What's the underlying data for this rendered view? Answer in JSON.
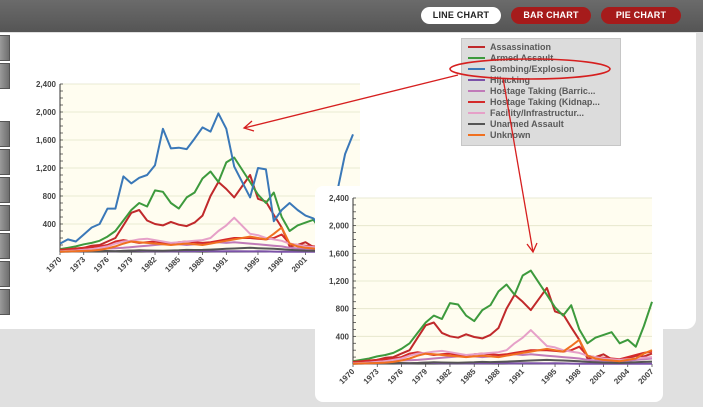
{
  "toolbar": {
    "line_chart_label": "LINE CHART",
    "bar_chart_label": "BAR CHART",
    "pie_chart_label": "PIE CHART"
  },
  "legend": {
    "items": [
      {
        "label": "Assassination",
        "color": "#c0292b"
      },
      {
        "label": "Armed Assault",
        "color": "#3d9a3d"
      },
      {
        "label": "Bombing/Explosion",
        "color": "#3a78b8"
      },
      {
        "label": "Hijacking",
        "color": "#7b52a8"
      },
      {
        "label": "Hostage Taking (Barric...",
        "color": "#c07ab8"
      },
      {
        "label": "Hostage Taking (Kidnap...",
        "color": "#d42a2a"
      },
      {
        "label": "Facility/Infrastructur...",
        "color": "#e6a0c8"
      },
      {
        "label": "Unarmed Assault",
        "color": "#555555"
      },
      {
        "label": "Unknown",
        "color": "#f07020"
      }
    ]
  },
  "annotation": {
    "color": "#d61f1f"
  },
  "chart_data": [
    {
      "type": "line",
      "ylim": [
        0,
        2400
      ],
      "yticks": [
        "2,400",
        "2,000",
        "1,600",
        "1,200",
        "800",
        "400"
      ],
      "xtick_labels": [
        "1970",
        "1973",
        "1976",
        "1979",
        "1982",
        "1985",
        "1988",
        "1991",
        "1995",
        "1998",
        "2001"
      ],
      "x": [
        1970,
        1971,
        1972,
        1973,
        1974,
        1975,
        1976,
        1977,
        1978,
        1979,
        1980,
        1981,
        1982,
        1983,
        1984,
        1985,
        1986,
        1987,
        1988,
        1989,
        1990,
        1991,
        1992,
        1994,
        1995,
        1996,
        1997,
        1998,
        1999,
        2000,
        2001,
        2002,
        2003,
        2004,
        2005,
        2006,
        2007
      ],
      "series": [
        {
          "name": "Assassination",
          "color": "#c0292b",
          "values": [
            20,
            30,
            40,
            60,
            90,
            100,
            150,
            200,
            380,
            560,
            600,
            450,
            400,
            380,
            430,
            390,
            370,
            420,
            520,
            800,
            1000,
            900,
            780,
            1100,
            760,
            720,
            530,
            350,
            80,
            100,
            140,
            70,
            60,
            80,
            120,
            110,
            150
          ]
        },
        {
          "name": "Armed Assault",
          "color": "#3d9a3d",
          "values": [
            40,
            60,
            80,
            110,
            130,
            160,
            220,
            300,
            450,
            600,
            700,
            650,
            880,
            860,
            700,
            620,
            780,
            850,
            1050,
            1150,
            1000,
            1280,
            1350,
            1000,
            820,
            700,
            850,
            500,
            300,
            380,
            420,
            460,
            300,
            350,
            250,
            550,
            900
          ]
        },
        {
          "name": "Bombing/Explosion",
          "color": "#3a78b8",
          "values": [
            120,
            180,
            150,
            250,
            350,
            400,
            620,
            620,
            1080,
            980,
            1060,
            1100,
            1240,
            1760,
            1480,
            1490,
            1470,
            1620,
            1780,
            1720,
            1980,
            1760,
            1220,
            780,
            1200,
            1180,
            440,
            600,
            700,
            600,
            520,
            480,
            360,
            560,
            860,
            1400,
            1680
          ]
        },
        {
          "name": "Hijacking",
          "color": "#7b52a8",
          "values": [
            10,
            15,
            12,
            10,
            20,
            15,
            12,
            10,
            15,
            20,
            15,
            10,
            12,
            10,
            8,
            10,
            12,
            10,
            15,
            10,
            8,
            10,
            12,
            8,
            10,
            8,
            6,
            5,
            5,
            5,
            4,
            4,
            3,
            4,
            5,
            4,
            3
          ]
        },
        {
          "name": "Hostage Taking (Barricade Incident)",
          "color": "#c07ab8",
          "values": [
            20,
            25,
            30,
            35,
            40,
            45,
            50,
            55,
            60,
            70,
            80,
            90,
            100,
            110,
            120,
            110,
            100,
            110,
            120,
            130,
            140,
            130,
            140,
            120,
            110,
            100,
            90,
            80,
            60,
            50,
            40,
            35,
            40,
            45,
            60,
            70,
            80
          ]
        },
        {
          "name": "Hostage Taking (Kidnapping)",
          "color": "#d42a2a",
          "values": [
            30,
            40,
            50,
            60,
            70,
            80,
            100,
            150,
            170,
            150,
            130,
            140,
            150,
            130,
            120,
            140,
            150,
            140,
            130,
            140,
            160,
            180,
            200,
            200,
            190,
            180,
            200,
            250,
            120,
            100,
            90,
            80,
            70,
            100,
            130,
            160,
            180
          ]
        },
        {
          "name": "Facility/Infrastructure Attack",
          "color": "#e6a0c8",
          "values": [
            10,
            15,
            20,
            30,
            40,
            60,
            80,
            120,
            150,
            160,
            180,
            190,
            170,
            150,
            130,
            140,
            150,
            160,
            170,
            200,
            300,
            380,
            490,
            260,
            240,
            200,
            180,
            160,
            120,
            100,
            80,
            70,
            60,
            70,
            80,
            90,
            100
          ]
        },
        {
          "name": "Unarmed Assault",
          "color": "#555555",
          "values": [
            5,
            6,
            8,
            10,
            12,
            15,
            14,
            12,
            15,
            20,
            25,
            22,
            20,
            18,
            22,
            25,
            30,
            28,
            30,
            35,
            40,
            45,
            50,
            60,
            55,
            50,
            45,
            40,
            30,
            25,
            20,
            18,
            15,
            20,
            25,
            30,
            35
          ]
        },
        {
          "name": "Unknown",
          "color": "#f07020",
          "values": [
            5,
            8,
            10,
            15,
            20,
            30,
            50,
            80,
            120,
            150,
            140,
            130,
            120,
            110,
            100,
            110,
            120,
            110,
            100,
            120,
            140,
            160,
            180,
            220,
            200,
            180,
            260,
            350,
            120,
            80,
            60,
            50,
            40,
            60,
            80,
            150,
            200
          ]
        }
      ]
    },
    {
      "type": "line",
      "ylim": [
        0,
        2400
      ],
      "yticks": [
        "2,400",
        "2,000",
        "1,600",
        "1,200",
        "800",
        "400"
      ],
      "xtick_labels": [
        "1970",
        "1973",
        "1976",
        "1979",
        "1982",
        "1985",
        "1988",
        "1991",
        "1995",
        "1998",
        "2001",
        "2004",
        "2007"
      ],
      "x": [
        1970,
        1971,
        1972,
        1973,
        1974,
        1975,
        1976,
        1977,
        1978,
        1979,
        1980,
        1981,
        1982,
        1983,
        1984,
        1985,
        1986,
        1987,
        1988,
        1989,
        1990,
        1991,
        1992,
        1994,
        1995,
        1996,
        1997,
        1998,
        1999,
        2000,
        2001,
        2002,
        2003,
        2004,
        2005,
        2006,
        2007
      ],
      "series": [
        {
          "name": "Assassination",
          "color": "#c0292b",
          "values": [
            20,
            30,
            40,
            60,
            90,
            100,
            150,
            200,
            380,
            560,
            600,
            450,
            400,
            380,
            430,
            390,
            370,
            420,
            520,
            800,
            1000,
            900,
            780,
            1100,
            760,
            720,
            530,
            350,
            80,
            100,
            140,
            70,
            60,
            80,
            120,
            110,
            150
          ]
        },
        {
          "name": "Armed Assault",
          "color": "#3d9a3d",
          "values": [
            40,
            60,
            80,
            110,
            130,
            160,
            220,
            300,
            450,
            600,
            700,
            650,
            880,
            860,
            700,
            620,
            780,
            850,
            1050,
            1150,
            1000,
            1280,
            1350,
            1000,
            820,
            700,
            850,
            500,
            300,
            380,
            420,
            460,
            300,
            350,
            250,
            550,
            900
          ]
        },
        {
          "name": "Hijacking",
          "color": "#7b52a8",
          "values": [
            10,
            15,
            12,
            10,
            20,
            15,
            12,
            10,
            15,
            20,
            15,
            10,
            12,
            10,
            8,
            10,
            12,
            10,
            15,
            10,
            8,
            10,
            12,
            8,
            10,
            8,
            6,
            5,
            5,
            5,
            4,
            4,
            3,
            4,
            5,
            4,
            3
          ]
        },
        {
          "name": "Hostage Taking (Barricade Incident)",
          "color": "#c07ab8",
          "values": [
            20,
            25,
            30,
            35,
            40,
            45,
            50,
            55,
            60,
            70,
            80,
            90,
            100,
            110,
            120,
            110,
            100,
            110,
            120,
            130,
            140,
            130,
            140,
            120,
            110,
            100,
            90,
            80,
            60,
            50,
            40,
            35,
            40,
            45,
            60,
            70,
            80
          ]
        },
        {
          "name": "Hostage Taking (Kidnapping)",
          "color": "#d42a2a",
          "values": [
            30,
            40,
            50,
            60,
            70,
            80,
            100,
            150,
            170,
            150,
            130,
            140,
            150,
            130,
            120,
            140,
            150,
            140,
            130,
            140,
            160,
            180,
            200,
            200,
            190,
            180,
            200,
            250,
            120,
            100,
            90,
            80,
            70,
            100,
            130,
            160,
            180
          ]
        },
        {
          "name": "Facility/Infrastructure Attack",
          "color": "#e6a0c8",
          "values": [
            10,
            15,
            20,
            30,
            40,
            60,
            80,
            120,
            150,
            160,
            180,
            190,
            170,
            150,
            130,
            140,
            150,
            160,
            170,
            200,
            300,
            380,
            490,
            260,
            240,
            200,
            180,
            160,
            120,
            100,
            80,
            70,
            60,
            70,
            80,
            90,
            100
          ]
        },
        {
          "name": "Unarmed Assault",
          "color": "#555555",
          "values": [
            5,
            6,
            8,
            10,
            12,
            15,
            14,
            12,
            15,
            20,
            25,
            22,
            20,
            18,
            22,
            25,
            30,
            28,
            30,
            35,
            40,
            45,
            50,
            60,
            55,
            50,
            45,
            40,
            30,
            25,
            20,
            18,
            15,
            20,
            25,
            30,
            35
          ]
        },
        {
          "name": "Unknown",
          "color": "#f07020",
          "values": [
            5,
            8,
            10,
            15,
            20,
            30,
            50,
            80,
            120,
            150,
            140,
            130,
            120,
            110,
            100,
            110,
            120,
            110,
            100,
            120,
            140,
            160,
            180,
            220,
            200,
            180,
            260,
            350,
            120,
            80,
            60,
            50,
            40,
            60,
            80,
            150,
            200
          ]
        }
      ]
    }
  ]
}
